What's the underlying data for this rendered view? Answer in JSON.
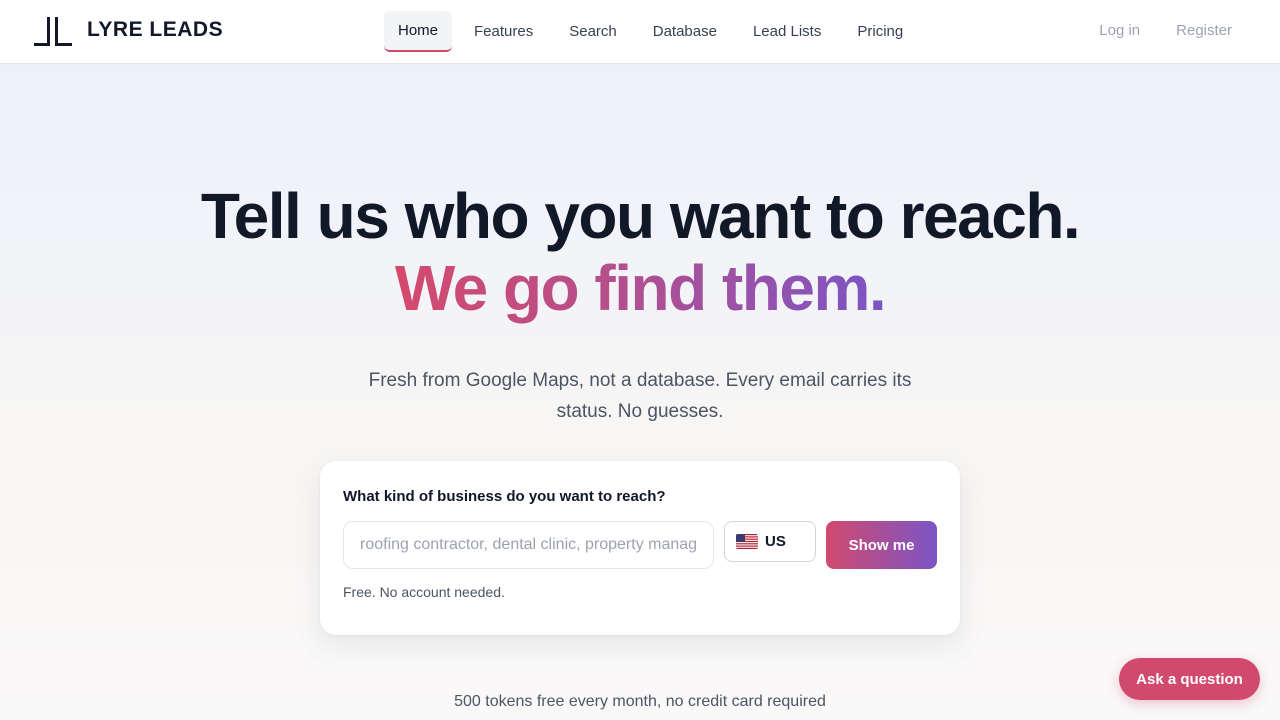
{
  "header": {
    "brand": "LYRE LEADS",
    "logo_icon": "lyre-logo-icon",
    "nav": [
      {
        "label": "Home",
        "active": true
      },
      {
        "label": "Features",
        "active": false
      },
      {
        "label": "Search",
        "active": false
      },
      {
        "label": "Database",
        "active": false
      },
      {
        "label": "Lead Lists",
        "active": false
      },
      {
        "label": "Pricing",
        "active": false
      }
    ],
    "login_label": "Log in",
    "register_label": "Register"
  },
  "hero": {
    "title": "Tell us who you want to reach.",
    "accent": "We go find them.",
    "subtitle": "Fresh from Google Maps, not a database. Every email carries its status. No guesses."
  },
  "search": {
    "label": "What kind of business do you want to reach?",
    "placeholder": "roofing contractor, dental clinic, property manager",
    "value": "",
    "country_flag_icon": "us-flag-icon",
    "country": "US",
    "button_label": "Show me",
    "note": "Free. No account needed."
  },
  "footer_note": "500 tokens free every month, no credit card required",
  "chat_button_label": "Ask a question",
  "colors": {
    "accent_start": "#d14a6e",
    "accent_end": "#7b55c6",
    "text_dark": "#111827",
    "text_muted": "#4b5563"
  }
}
